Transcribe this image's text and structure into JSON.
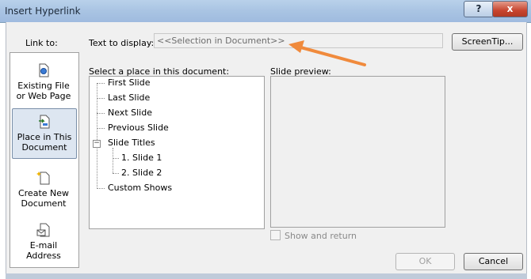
{
  "window": {
    "title": "Insert Hyperlink"
  },
  "link_to": {
    "label": "Link to:",
    "items": [
      {
        "line1": "Existing File",
        "line2": "or Web Page",
        "icon": "document-globe-icon"
      },
      {
        "line1": "Place in This",
        "line2": "Document",
        "icon": "document-place-icon"
      },
      {
        "line1": "Create New",
        "line2": "Document",
        "icon": "new-document-icon"
      },
      {
        "line1": "E-mail",
        "line2": "Address",
        "icon": "email-icon"
      }
    ],
    "selected_index": 1
  },
  "text_to_display": {
    "label": "Text to display:",
    "value": "<<Selection in Document>>"
  },
  "screentip": {
    "label": "ScreenTip..."
  },
  "place": {
    "label": "Select a place in this document:",
    "tree": {
      "first_slide": "First Slide",
      "last_slide": "Last Slide",
      "next_slide": "Next Slide",
      "previous_slide": "Previous Slide",
      "slide_titles": "Slide Titles",
      "slide1": "1. Slide 1",
      "slide2": "2. Slide 2",
      "custom_shows": "Custom Shows",
      "expander_symbol": "−"
    }
  },
  "preview": {
    "label": "Slide preview:",
    "show_and_return": "Show and return"
  },
  "buttons": {
    "ok": "OK",
    "cancel": "Cancel",
    "help": "?",
    "close": "x"
  },
  "colors": {
    "arrow": "#f08a3c",
    "title_gradient_top": "#b9d1ea"
  }
}
